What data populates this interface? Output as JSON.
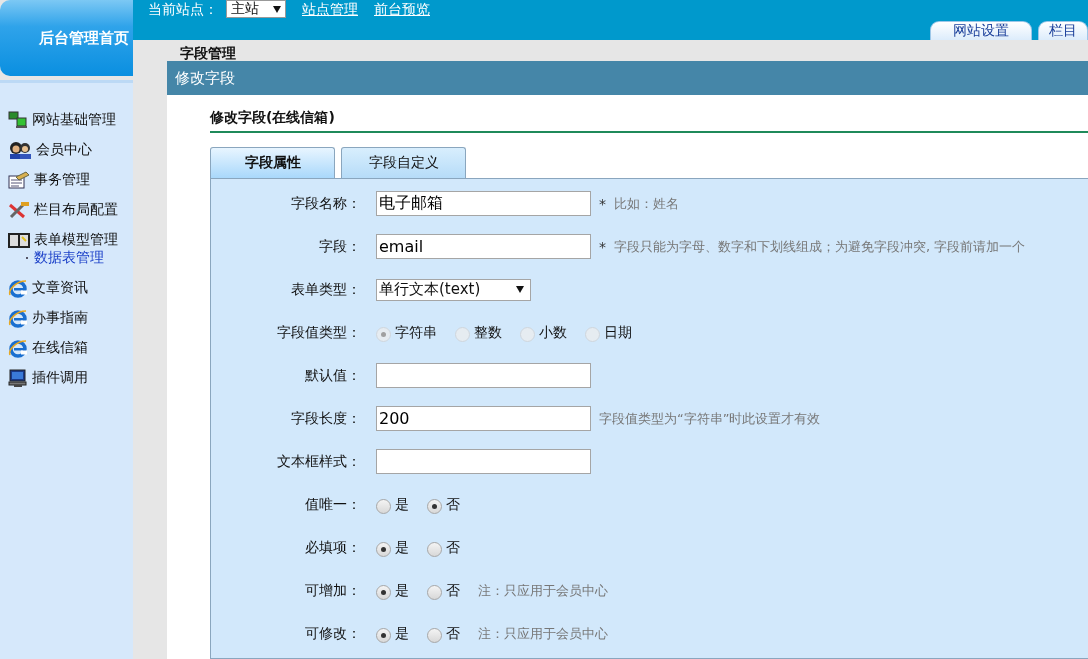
{
  "header": {
    "logo_title": "后台管理首页",
    "site_label": "当前站点：",
    "site_select": "主站",
    "links": [
      "站点管理",
      "前台预览"
    ],
    "tabs": [
      {
        "label": "网站设置"
      },
      {
        "label": "栏目"
      }
    ]
  },
  "sidebar": {
    "items": [
      {
        "label": "网站基础管理"
      },
      {
        "label": "会员中心"
      },
      {
        "label": "事务管理"
      },
      {
        "label": "栏目布局配置"
      },
      {
        "label": "表单模型管理",
        "children": [
          {
            "label": "数据表管理",
            "selected": true
          }
        ]
      },
      {
        "label": "文章资讯"
      },
      {
        "label": "办事指南"
      },
      {
        "label": "在线信箱"
      },
      {
        "label": "插件调用"
      }
    ]
  },
  "page_title": "字段管理",
  "dialog": {
    "title": "修改字段",
    "heading": "修改字段(在线信箱)",
    "tabs": [
      {
        "label": "字段属性",
        "selected": true
      },
      {
        "label": "字段自定义",
        "selected": false
      }
    ],
    "rows": [
      {
        "kind": "text",
        "label": "字段名称：",
        "value": "电子邮箱",
        "required_mark": "*",
        "hint": "比如：姓名"
      },
      {
        "kind": "text",
        "label": "字段：",
        "value": "email",
        "required_mark": "*",
        "hint": "字段只能为字母、数字和下划线组成；为避免字段冲突, 字段前请加一个"
      },
      {
        "kind": "select",
        "label": "表单类型：",
        "value": "单行文本(text)"
      },
      {
        "kind": "radio",
        "label": "字段值类型：",
        "disabled": true,
        "options": [
          {
            "label": "字符串",
            "selected": true
          },
          {
            "label": "整数",
            "selected": false
          },
          {
            "label": "小数",
            "selected": false
          },
          {
            "label": "日期",
            "selected": false
          }
        ]
      },
      {
        "kind": "text",
        "label": "默认值："
      },
      {
        "kind": "text",
        "label": "字段长度：",
        "value": "200",
        "hint": "字段值类型为“字符串”时此设置才有效"
      },
      {
        "kind": "text",
        "label": "文本框样式："
      },
      {
        "kind": "radio",
        "label": "值唯一：",
        "disabled": false,
        "options": [
          {
            "label": "是",
            "selected": false
          },
          {
            "label": "否",
            "selected": true
          }
        ]
      },
      {
        "kind": "radio",
        "label": "必填项：",
        "disabled": false,
        "options": [
          {
            "label": "是",
            "selected": true
          },
          {
            "label": "否",
            "selected": false
          }
        ]
      },
      {
        "kind": "radio",
        "label": "可增加：",
        "disabled": false,
        "options": [
          {
            "label": "是",
            "selected": true
          },
          {
            "label": "否",
            "selected": false
          }
        ],
        "hint": "注：只应用于会员中心"
      },
      {
        "kind": "radio",
        "label": "可修改：",
        "disabled": false,
        "options": [
          {
            "label": "是",
            "selected": true
          },
          {
            "label": "否",
            "selected": false
          }
        ],
        "hint": "注：只应用于会员中心"
      }
    ]
  }
}
